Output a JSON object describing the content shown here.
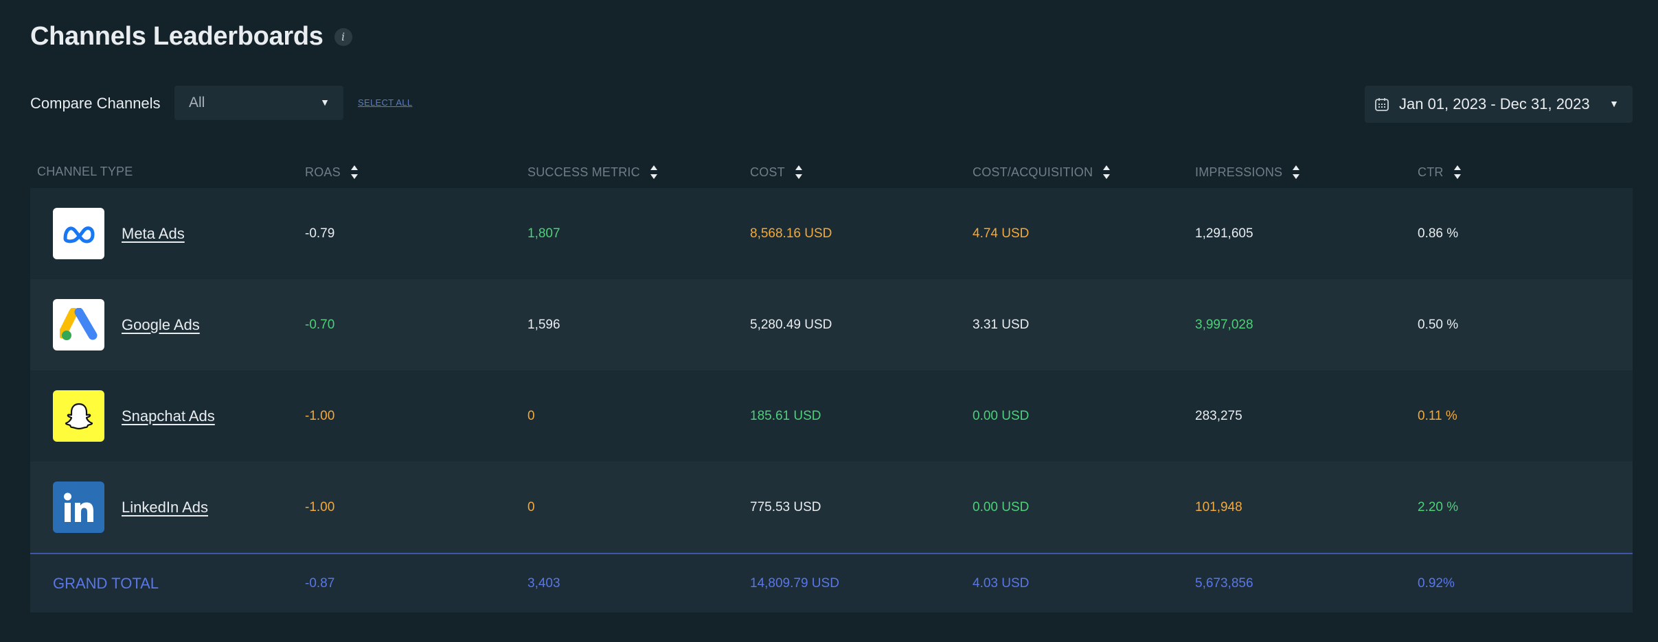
{
  "header": {
    "title": "Channels Leaderboards",
    "info_glyph": "i"
  },
  "controls": {
    "compare_label": "Compare Channels",
    "channel_select_value": "All",
    "select_all_label": "SELECT ALL",
    "date_range": "Jan 01, 2023 - Dec 31, 2023"
  },
  "table": {
    "columns": [
      "CHANNEL TYPE",
      "ROAS",
      "SUCCESS METRIC",
      "COST",
      "COST/ACQUISITION",
      "IMPRESSIONS",
      "CTR"
    ],
    "rows": [
      {
        "channel": "Meta Ads",
        "icon": "meta-logo-icon",
        "roas": "-0.79",
        "success": "1,807",
        "cost": "8,568.16 USD",
        "cpa": "4.74 USD",
        "impressions": "1,291,605",
        "ctr": "0.86 %"
      },
      {
        "channel": "Google Ads",
        "icon": "google-ads-logo-icon",
        "roas": "-0.70",
        "success": "1,596",
        "cost": "5,280.49 USD",
        "cpa": "3.31 USD",
        "impressions": "3,997,028",
        "ctr": "0.50 %"
      },
      {
        "channel": "Snapchat Ads",
        "icon": "snapchat-logo-icon",
        "roas": "-1.00",
        "success": "0",
        "cost": "185.61 USD",
        "cpa": "0.00 USD",
        "impressions": "283,275",
        "ctr": "0.11 %"
      },
      {
        "channel": "LinkedIn Ads",
        "icon": "linkedin-logo-icon",
        "roas": "-1.00",
        "success": "0",
        "cost": "775.53 USD",
        "cpa": "0.00 USD",
        "impressions": "101,948",
        "ctr": "2.20 %"
      }
    ],
    "total": {
      "label": "GRAND TOTAL",
      "roas": "-0.87",
      "success": "3,403",
      "cost": "14,809.79 USD",
      "cpa": "4.03 USD",
      "impressions": "5,673,856",
      "ctr": "0.92%"
    }
  },
  "colors": {
    "background": "#14222a",
    "positive": "#4ed07a",
    "warning": "#f4a93c",
    "total": "#5977e6",
    "linkedin": "#2a6fb5",
    "snapchat": "#fffc3c"
  }
}
